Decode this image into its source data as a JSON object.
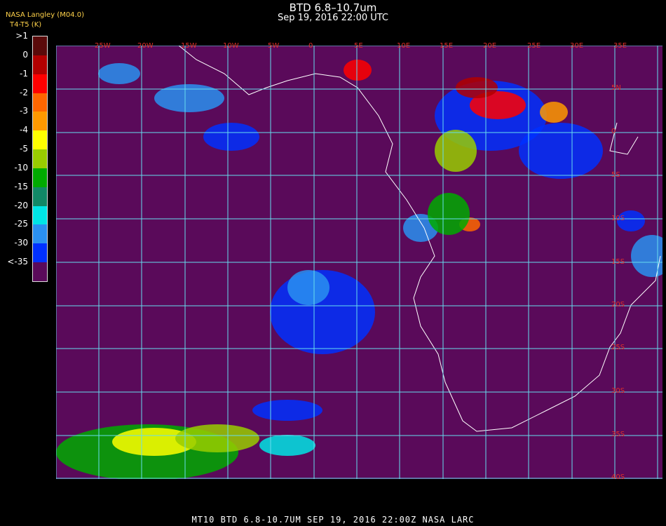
{
  "header": {
    "title": "BTD 6.8–10.7um",
    "subtitle": "Sep 19, 2016 22:00 UTC",
    "credit": "NASA Langley (M04.0)",
    "variable": "T4-T5 (K)"
  },
  "legend": {
    "labels": [
      ">1",
      "0",
      "-1",
      "-2",
      "-3",
      "-4",
      "-5",
      "-10",
      "-15",
      "-20",
      "-25",
      "-30",
      "<-35"
    ],
    "colors": [
      "#5a0a0a",
      "#b20000",
      "#ff0000",
      "#ff6600",
      "#ff9900",
      "#ffff00",
      "#99cc00",
      "#00aa00",
      "#118866",
      "#00e5e5",
      "#2a90f0",
      "#0030ff",
      "#5a0a5a"
    ]
  },
  "map": {
    "lon_labels": [
      "25W",
      "20W",
      "15W",
      "10W",
      "5W",
      "0",
      "5E",
      "10E",
      "15E",
      "20E",
      "25E",
      "30E",
      "35E"
    ],
    "lat_labels": [
      "5N",
      "0",
      "5S",
      "10S",
      "15S",
      "20S",
      "25S",
      "30S",
      "35S",
      "40S"
    ],
    "background_color": "#5a0a5a",
    "grid_color": "#66ddee",
    "coast_color": "#ffffff"
  },
  "footer": {
    "text": "MT10  BTD 6.8-10.7UM    SEP 19, 2016 22:00Z    NASA LARC"
  }
}
